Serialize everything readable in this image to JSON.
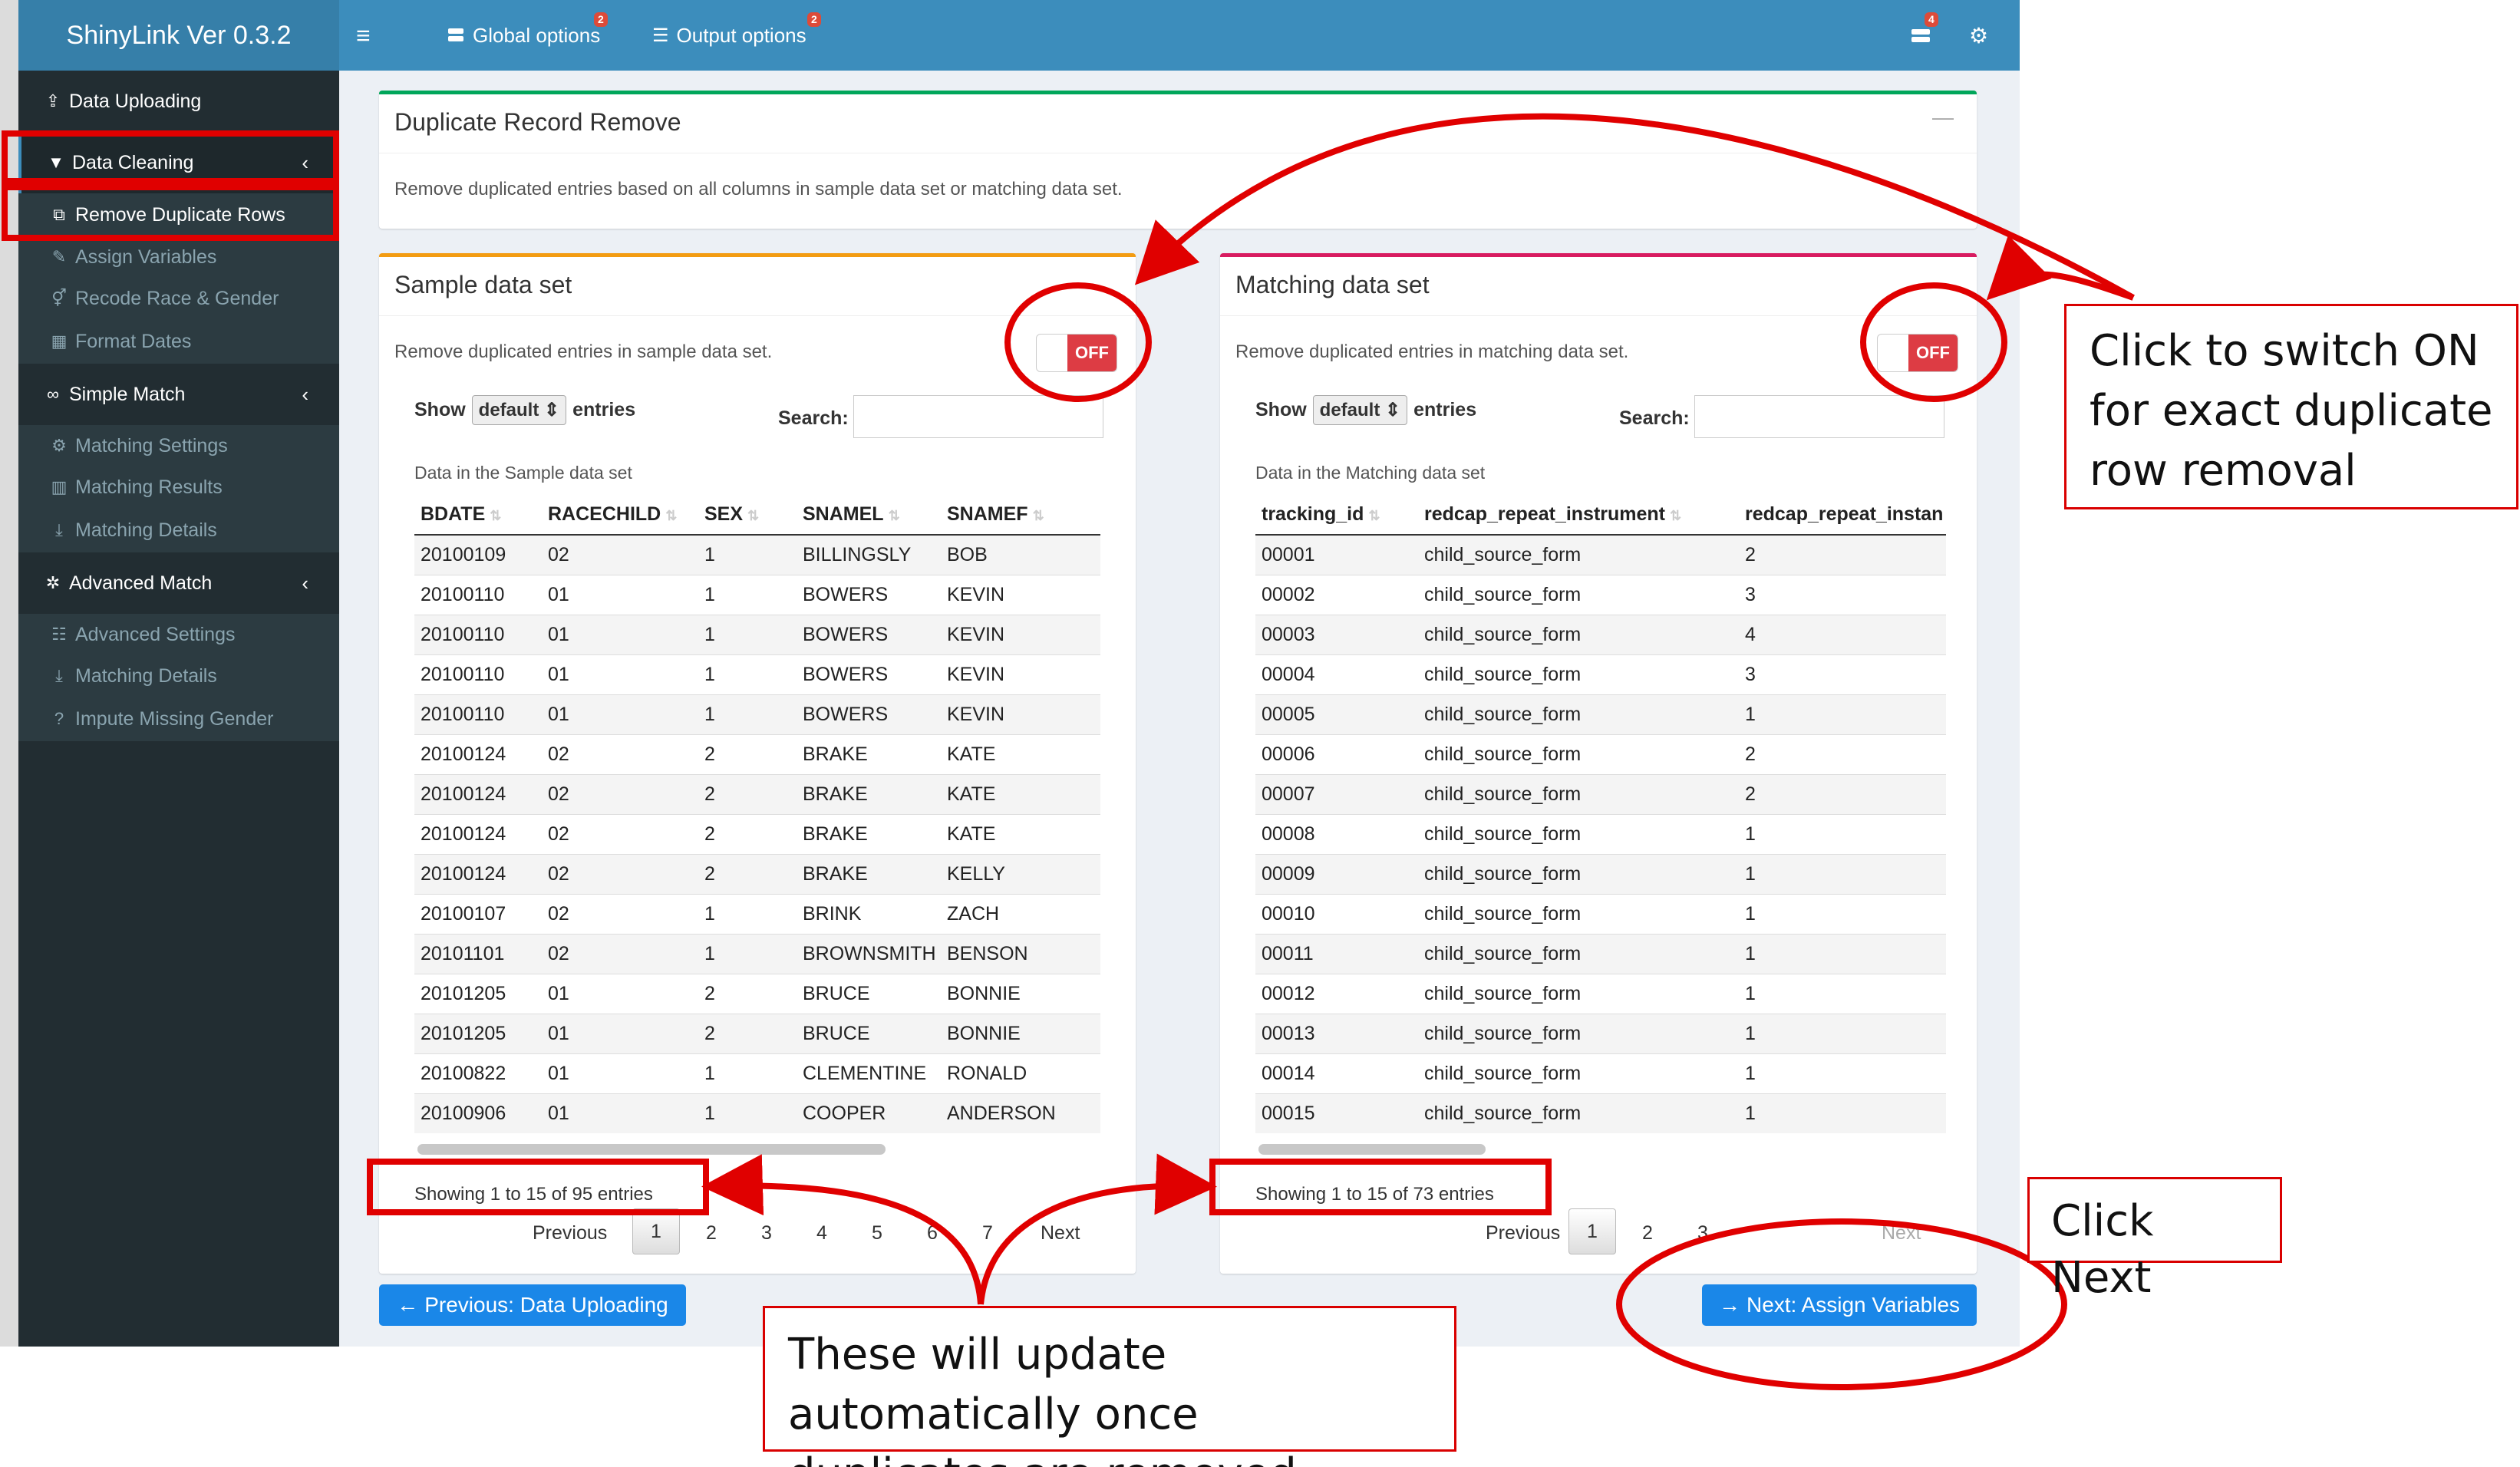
{
  "app": {
    "title": "ShinyLink Ver 0.3.2"
  },
  "topnav": {
    "menu_icon": "hamburger-icon",
    "global_options": "Global options",
    "global_badge": "2",
    "output_options": "Output options",
    "output_badge": "2",
    "notify_badge": "4"
  },
  "sidebar": {
    "data_uploading": "Data Uploading",
    "data_cleaning": "Data Cleaning",
    "remove_duplicate_rows": "Remove Duplicate Rows",
    "assign_variables": "Assign Variables",
    "recode_race_gender": "Recode Race & Gender",
    "format_dates": "Format Dates",
    "simple_match": "Simple Match",
    "matching_settings": "Matching Settings",
    "matching_results": "Matching Results",
    "matching_details": "Matching Details",
    "advanced_match": "Advanced Match",
    "advanced_settings": "Advanced Settings",
    "adv_matching_details": "Matching Details",
    "impute_missing_gender": "Impute Missing Gender"
  },
  "main": {
    "title": "Duplicate Record Remove",
    "description": "Remove duplicated entries based on all columns in sample data set or matching data set.",
    "collapse": "—"
  },
  "sample": {
    "title": "Sample data set",
    "desc": "Remove duplicated entries in sample data set.",
    "toggle": "OFF",
    "show": "Show",
    "length": "default",
    "entries": "entries",
    "search": "Search:",
    "caption": "Data in the Sample data set",
    "columns": [
      "BDATE",
      "RACECHILD",
      "SEX",
      "SNAMEL",
      "SNAMEF"
    ],
    "rows": [
      [
        "20100109",
        "02",
        "1",
        "BILLINGSLY",
        "BOB"
      ],
      [
        "20100110",
        "01",
        "1",
        "BOWERS",
        "KEVIN"
      ],
      [
        "20100110",
        "01",
        "1",
        "BOWERS",
        "KEVIN"
      ],
      [
        "20100110",
        "01",
        "1",
        "BOWERS",
        "KEVIN"
      ],
      [
        "20100110",
        "01",
        "1",
        "BOWERS",
        "KEVIN"
      ],
      [
        "20100124",
        "02",
        "2",
        "BRAKE",
        "KATE"
      ],
      [
        "20100124",
        "02",
        "2",
        "BRAKE",
        "KATE"
      ],
      [
        "20100124",
        "02",
        "2",
        "BRAKE",
        "KATE"
      ],
      [
        "20100124",
        "02",
        "2",
        "BRAKE",
        "KELLY"
      ],
      [
        "20100107",
        "02",
        "1",
        "BRINK",
        "ZACH"
      ],
      [
        "20101101",
        "02",
        "1",
        "BROWNSMITH",
        "BENSON"
      ],
      [
        "20101205",
        "01",
        "2",
        "BRUCE",
        "BONNIE"
      ],
      [
        "20101205",
        "01",
        "2",
        "BRUCE",
        "BONNIE"
      ],
      [
        "20100822",
        "01",
        "1",
        "CLEMENTINE",
        "RONALD"
      ],
      [
        "20100906",
        "01",
        "1",
        "COOPER",
        "ANDERSON"
      ]
    ],
    "info": "Showing 1 to 15 of 95 entries",
    "previous": "Previous",
    "pages": [
      "1",
      "2",
      "3",
      "4",
      "5",
      "6",
      "7"
    ],
    "next": "Next"
  },
  "matching": {
    "title": "Matching data set",
    "desc": "Remove duplicated entries in matching data set.",
    "toggle": "OFF",
    "show": "Show",
    "length": "default",
    "entries": "entries",
    "search": "Search:",
    "caption": "Data in the Matching data set",
    "columns": [
      "tracking_id",
      "redcap_repeat_instrument",
      "redcap_repeat_instan"
    ],
    "rows": [
      [
        "00001",
        "child_source_form",
        "2"
      ],
      [
        "00002",
        "child_source_form",
        "3"
      ],
      [
        "00003",
        "child_source_form",
        "4"
      ],
      [
        "00004",
        "child_source_form",
        "3"
      ],
      [
        "00005",
        "child_source_form",
        "1"
      ],
      [
        "00006",
        "child_source_form",
        "2"
      ],
      [
        "00007",
        "child_source_form",
        "2"
      ],
      [
        "00008",
        "child_source_form",
        "1"
      ],
      [
        "00009",
        "child_source_form",
        "1"
      ],
      [
        "00010",
        "child_source_form",
        "1"
      ],
      [
        "00011",
        "child_source_form",
        "1"
      ],
      [
        "00012",
        "child_source_form",
        "1"
      ],
      [
        "00013",
        "child_source_form",
        "1"
      ],
      [
        "00014",
        "child_source_form",
        "1"
      ],
      [
        "00015",
        "child_source_form",
        "1"
      ]
    ],
    "info": "Showing 1 to 15 of 73 entries",
    "previous": "Previous",
    "pages": [
      "1",
      "2",
      "3"
    ],
    "next": "Next"
  },
  "buttons": {
    "prev": "Previous: Data Uploading",
    "next": "Next: Assign Variables"
  },
  "annotations": {
    "toggle_note": "Click to switch ON for exact duplicate row removal",
    "next_note": "Click Next",
    "update_note": "These will update automatically once duplicates are removed"
  },
  "colors": {
    "header": "#3c8dbc",
    "brand": "#367fa9",
    "sidebar": "#222d32",
    "content": "#ecf0f5",
    "annotation_red": "#e00000",
    "sample_border": "#f39c12",
    "matching_border": "#d81b60",
    "main_border": "#00a65a"
  }
}
